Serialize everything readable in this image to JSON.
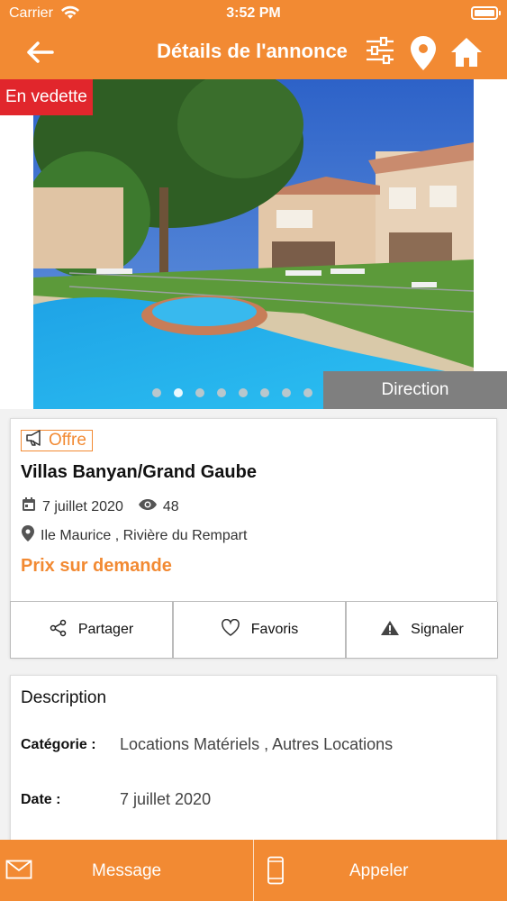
{
  "status_bar": {
    "carrier": "Carrier",
    "time": "3:52 PM"
  },
  "nav": {
    "title": "Détails de l'annonce",
    "icons": [
      "arrow-left-icon",
      "filter-sliders-icon",
      "map-pin-icon",
      "home-icon"
    ]
  },
  "hero": {
    "badge": "En vedette",
    "direction_label": "Direction",
    "photo_count": 8,
    "active_photo_index": 1
  },
  "listing": {
    "tag": "Offre",
    "title": "Villas Banyan/Grand Gaube",
    "date": "7 juillet 2020",
    "views": "48",
    "location": "Ile Maurice , Rivière du Rempart",
    "price": "Prix sur demande"
  },
  "actions": {
    "share": "Partager",
    "favorite": "Favoris",
    "report": "Signaler"
  },
  "description": {
    "heading": "Description",
    "category_label": "Catégorie :",
    "category_value": "Locations Matériels , Autres Locations",
    "date_label": "Date :",
    "date_value": "7 juillet 2020"
  },
  "bottom": {
    "message": "Message",
    "call": "Appeler"
  },
  "colors": {
    "accent": "#f28a33",
    "badge_red": "#e1262c",
    "direction_gray": "#7f7f7f"
  }
}
